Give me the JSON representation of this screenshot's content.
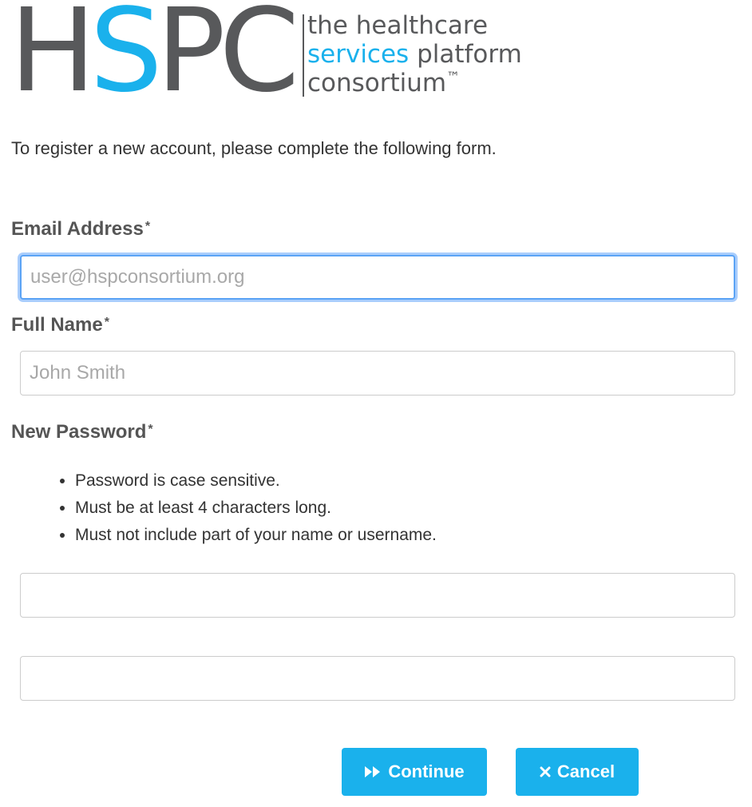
{
  "logo": {
    "letters": [
      "H",
      "S",
      "P",
      "C"
    ],
    "tagline": {
      "line1": "the healthcare",
      "line2_accent": "services",
      "line2_rest": "platform",
      "line3": "consortium",
      "trademark": "™"
    }
  },
  "intro_text": "To register a new account, please complete the following form.",
  "form": {
    "email": {
      "label": "Email Address",
      "required_mark": "*",
      "value": "",
      "placeholder": "user@hspconsortium.org"
    },
    "full_name": {
      "label": "Full Name",
      "required_mark": "*",
      "value": "",
      "placeholder": "John Smith"
    },
    "password": {
      "label": "New Password",
      "required_mark": "*",
      "rules": [
        "Password is case sensitive.",
        "Must be at least 4 characters long.",
        "Must not include part of your name or username."
      ],
      "value": "",
      "confirm_value": ""
    }
  },
  "buttons": {
    "continue": {
      "label": "Continue",
      "icon": "fast-forward-icon"
    },
    "cancel": {
      "label": "Cancel",
      "icon": "close-icon"
    }
  },
  "colors": {
    "brand_blue": "#1ab1ec",
    "brand_grey": "#58595b",
    "focus_ring": "#5ba3f5"
  }
}
